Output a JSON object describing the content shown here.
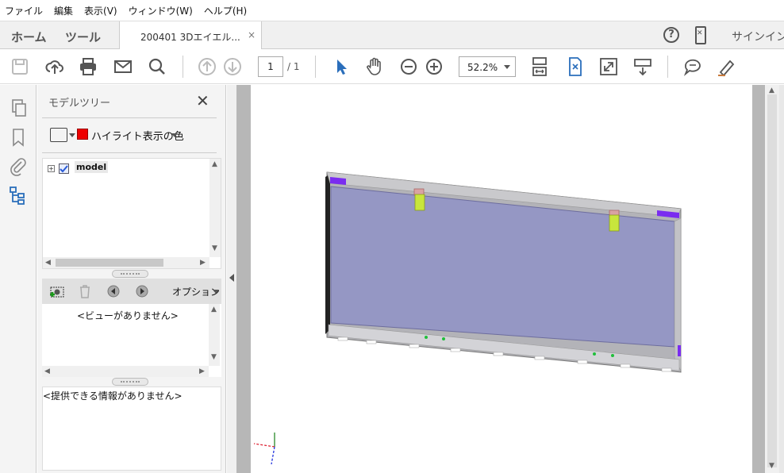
{
  "menu": [
    "ファイル",
    "編集",
    "表示(V)",
    "ウィンドウ(W)",
    "ヘルプ(H)"
  ],
  "tabs": {
    "home": "ホーム",
    "tools": "ツール",
    "document": "200401  3Dエイエル...",
    "close": "×",
    "help": "?",
    "signin": "サインイン"
  },
  "toolbar": {
    "page_current": "1",
    "page_total": "/ 1",
    "zoom": "52.2%"
  },
  "panel": {
    "title": "モデルツリー",
    "highlight_label": "ハイライト表示の色",
    "highlight_color": "#ee0000",
    "tree_root": "model",
    "options_label": "オプション",
    "no_views": "<ビューがありません>",
    "no_info": "<提供できる情報がありません>"
  },
  "colors": {
    "panel_bg": "#f4f4f4",
    "document_bg": "#b7b7b7",
    "accent_cursor": "#2a6ebb",
    "model_face": "#9597c4",
    "model_marker": "#7a2cf0",
    "clip_color": "#c8e63c"
  }
}
